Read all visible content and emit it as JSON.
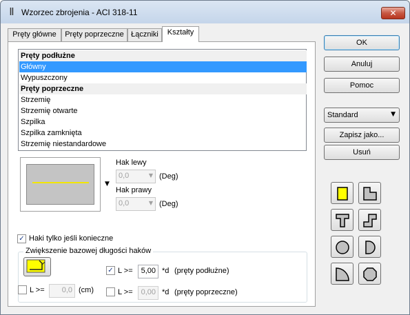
{
  "window": {
    "title": "Wzorzec zbrojenia - ACI 318-11",
    "title_icon": "rebar-icon",
    "close_glyph": "✕"
  },
  "tabs": [
    {
      "label": "Pręty główne",
      "active": false
    },
    {
      "label": "Pręty poprzeczne",
      "active": false
    },
    {
      "label": "Łączniki",
      "active": false
    },
    {
      "label": "Kształty",
      "active": true
    }
  ],
  "shape_list": {
    "items": [
      {
        "label": "Pręty podłużne",
        "type": "group"
      },
      {
        "label": "Główny",
        "type": "item",
        "selected": true
      },
      {
        "label": "Wypuszczony",
        "type": "item"
      },
      {
        "label": "Pręty poprzeczne",
        "type": "group"
      },
      {
        "label": "Strzemię",
        "type": "item"
      },
      {
        "label": "Strzemię otwarte",
        "type": "item"
      },
      {
        "label": "Szpilka",
        "type": "item"
      },
      {
        "label": "Szpilka zamknięta",
        "type": "item"
      },
      {
        "label": "Strzemię niestandardowe",
        "type": "item"
      }
    ]
  },
  "hooks": {
    "left_label": "Hak lewy",
    "left_value": "0,0",
    "left_unit": "(Deg)",
    "right_label": "Hak prawy",
    "right_value": "0,0",
    "right_unit": "(Deg)"
  },
  "hooks_if_needed": {
    "label": "Haki tylko jeśli konieczne",
    "checked": true
  },
  "length_group": {
    "title": "Zwiększenie bazowej długości haków",
    "row1": {
      "checked": true,
      "label": "L >=",
      "value": "5,00",
      "unit": "*d",
      "desc": "(pręty podłużne)"
    },
    "row2": {
      "checked": false,
      "label": "L >=",
      "value": "0,0",
      "unit": "(cm)"
    },
    "row3": {
      "checked": false,
      "label": "L >=",
      "value": "0,00",
      "unit": "*d",
      "desc": "(pręty poprzeczne)"
    }
  },
  "buttons": {
    "ok": "OK",
    "cancel": "Anuluj",
    "help": "Pomoc",
    "save_as": "Zapisz jako...",
    "delete": "Usuń"
  },
  "preset": {
    "value": "Standard"
  },
  "shape_palette": [
    "square-yellow-icon",
    "l-shape-icon",
    "t-shape-icon",
    "z-shape-icon",
    "circle-icon",
    "half-circle-icon",
    "quarter-circle-icon",
    "octagon-icon"
  ],
  "colors": {
    "selection": "#3399ff",
    "bar_line": "#f2e600",
    "shape_fill": "#c0c0c0",
    "shape_yellow": "#ffff00"
  }
}
